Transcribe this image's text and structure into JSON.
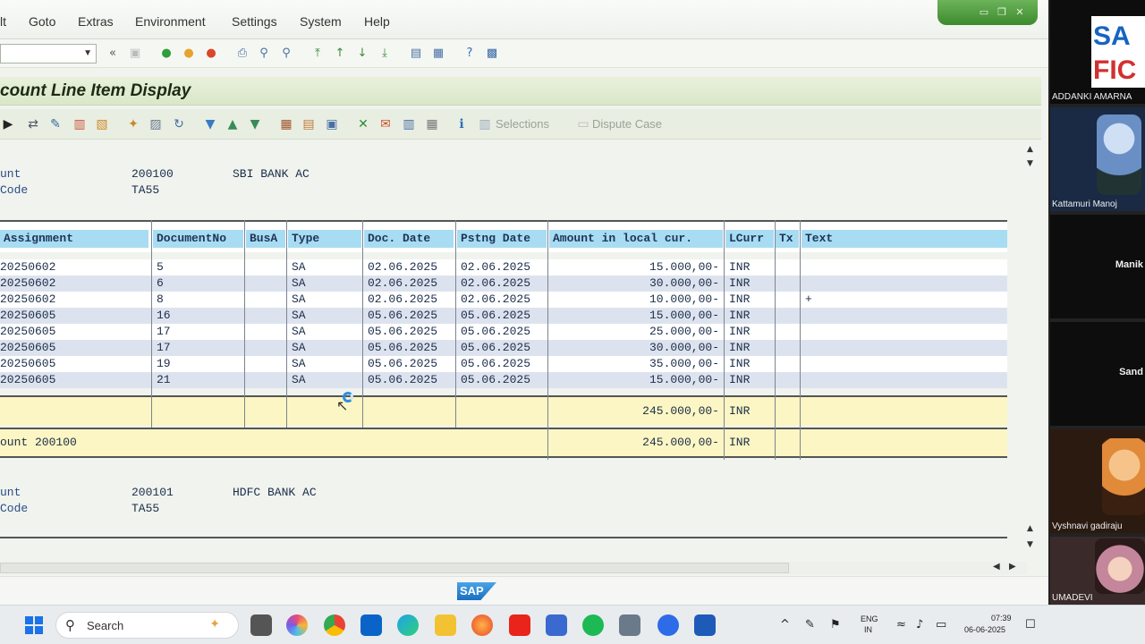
{
  "menu": {
    "items": [
      {
        "label": "lt"
      },
      {
        "label": "Goto"
      },
      {
        "label": "Extras"
      },
      {
        "label": "Environment"
      },
      {
        "label": "Settings"
      },
      {
        "label": "System"
      },
      {
        "label": "Help"
      }
    ]
  },
  "title": "count Line Item Display",
  "toolbar2": {
    "selections_label": "Selections",
    "dispute_label": "Dispute Case"
  },
  "account1": {
    "label_a": "unt",
    "label_b": "Code",
    "number": "200100",
    "name": "SBI BANK AC",
    "company_code": "TA55"
  },
  "account2": {
    "label_a": "unt",
    "label_b": "Code",
    "number": "200101",
    "name": "HDFC BANK AC",
    "company_code": "TA55"
  },
  "columns": [
    "Assignment",
    "DocumentNo",
    "BusA",
    "Type",
    "Doc. Date",
    "Pstng Date",
    "Amount in local cur.",
    "LCurr",
    "Tx",
    "Text"
  ],
  "rows": [
    {
      "assignment": "20250602",
      "doc": "5",
      "busa": "",
      "type": "SA",
      "doc_date": "02.06.2025",
      "pst_date": "02.06.2025",
      "amount": "15.000,00-",
      "curr": "INR",
      "tx": "",
      "text": ""
    },
    {
      "assignment": "20250602",
      "doc": "6",
      "busa": "",
      "type": "SA",
      "doc_date": "02.06.2025",
      "pst_date": "02.06.2025",
      "amount": "30.000,00-",
      "curr": "INR",
      "tx": "",
      "text": ""
    },
    {
      "assignment": "20250602",
      "doc": "8",
      "busa": "",
      "type": "SA",
      "doc_date": "02.06.2025",
      "pst_date": "02.06.2025",
      "amount": "10.000,00-",
      "curr": "INR",
      "tx": "",
      "text": "+"
    },
    {
      "assignment": "20250605",
      "doc": "16",
      "busa": "",
      "type": "SA",
      "doc_date": "05.06.2025",
      "pst_date": "05.06.2025",
      "amount": "15.000,00-",
      "curr": "INR",
      "tx": "",
      "text": ""
    },
    {
      "assignment": "20250605",
      "doc": "17",
      "busa": "",
      "type": "SA",
      "doc_date": "05.06.2025",
      "pst_date": "05.06.2025",
      "amount": "25.000,00-",
      "curr": "INR",
      "tx": "",
      "text": ""
    },
    {
      "assignment": "20250605",
      "doc": "17",
      "busa": "",
      "type": "SA",
      "doc_date": "05.06.2025",
      "pst_date": "05.06.2025",
      "amount": "30.000,00-",
      "curr": "INR",
      "tx": "",
      "text": ""
    },
    {
      "assignment": "20250605",
      "doc": "19",
      "busa": "",
      "type": "SA",
      "doc_date": "05.06.2025",
      "pst_date": "05.06.2025",
      "amount": "35.000,00-",
      "curr": "INR",
      "tx": "",
      "text": ""
    },
    {
      "assignment": "20250605",
      "doc": "21",
      "busa": "",
      "type": "SA",
      "doc_date": "05.06.2025",
      "pst_date": "05.06.2025",
      "amount": "15.000,00-",
      "curr": "INR",
      "tx": "",
      "text": ""
    }
  ],
  "subtotal": {
    "amount": "245.000,00-",
    "curr": "INR"
  },
  "total": {
    "label": "ount 200100",
    "amount": "245.000,00-",
    "curr": "INR"
  },
  "statusbar": {
    "logo": "SAP"
  },
  "participants": [
    {
      "name": "ADDANKI AMARNA",
      "badge": "SAP FICO"
    },
    {
      "name": "Kattamuri Manoj"
    },
    {
      "name": "",
      "mid": "Manik"
    },
    {
      "name": "",
      "mid": "Sand"
    },
    {
      "name": "Vyshnavi gadiraju"
    },
    {
      "name": "UMADEVI"
    }
  ],
  "taskbar": {
    "search_placeholder": "Search",
    "lang_top": "ENG",
    "lang_bottom": "IN",
    "time": "07:39",
    "date": "06-06-2025"
  }
}
